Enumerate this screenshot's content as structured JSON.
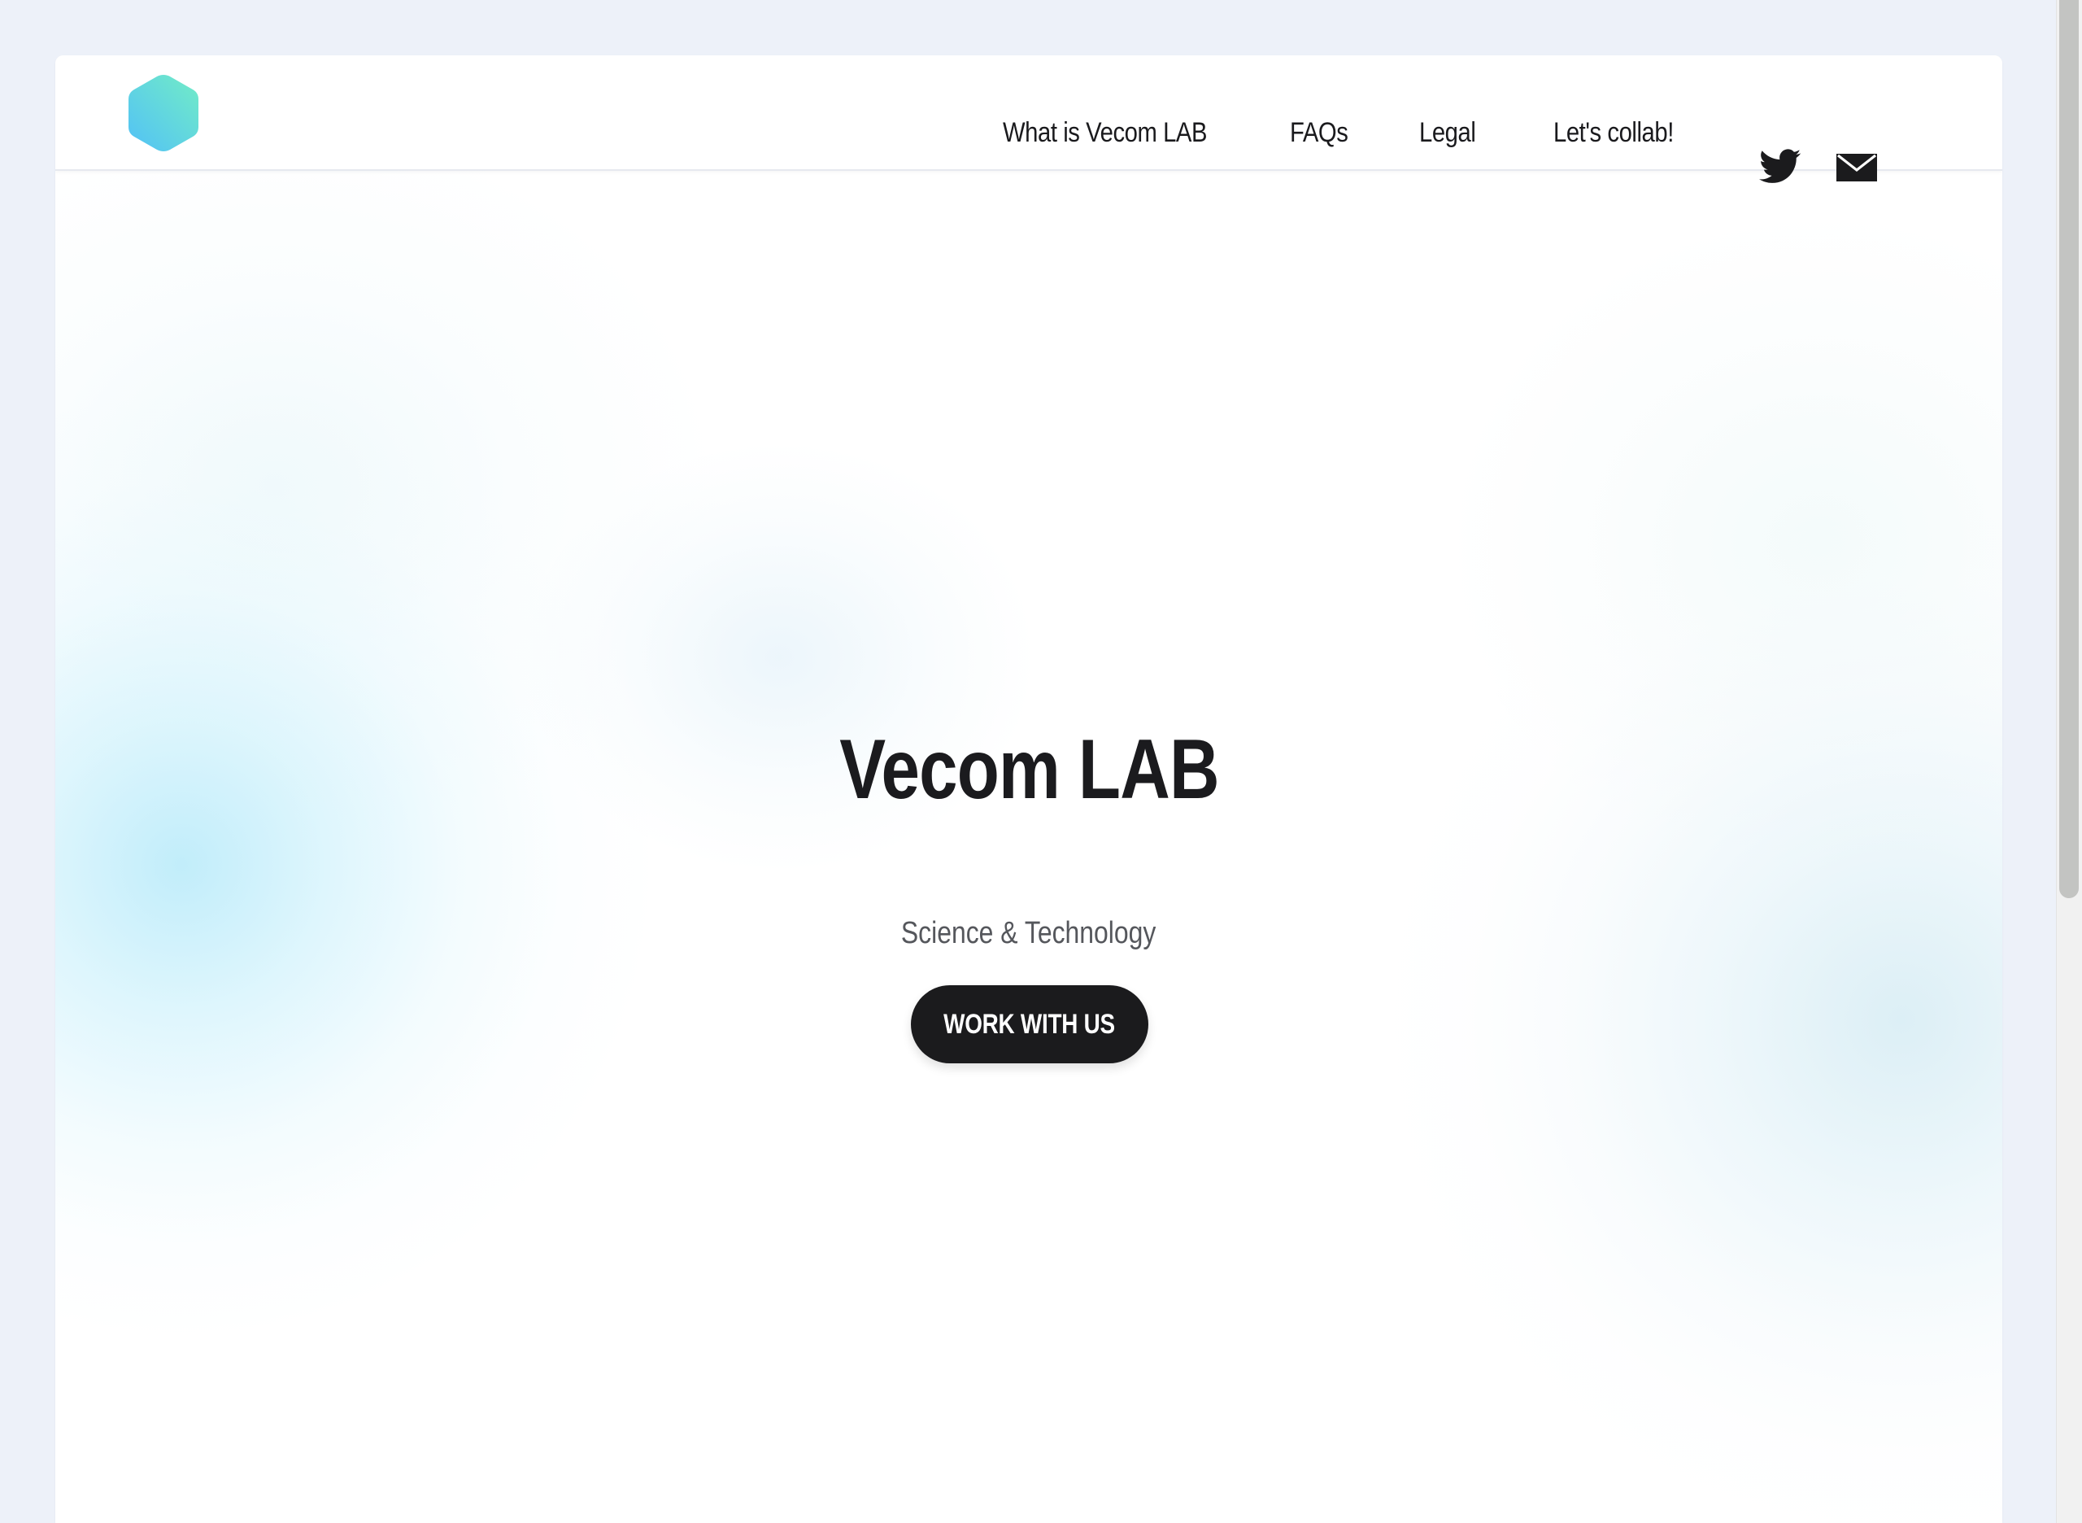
{
  "header": {
    "logo_name": "hexagon-logo",
    "nav": [
      {
        "label": "What is Vecom LAB"
      },
      {
        "label": "FAQs"
      },
      {
        "label": "Legal"
      },
      {
        "label": "Let's collab!"
      }
    ],
    "social_icons": [
      "twitter-icon",
      "mail-icon"
    ]
  },
  "hero": {
    "title": "Vecom LAB",
    "subtitle": "Science & Technology",
    "cta_label": "WORK WITH US"
  },
  "colors": {
    "page_background": "#edf1f9",
    "text_primary": "#1b1b1e",
    "text_secondary": "#55575c",
    "button_background": "#1b1b1d",
    "button_text": "#ffffff",
    "logo_gradient_start": "#5bc8f5",
    "logo_gradient_end": "#6ee7c9",
    "glow_cyan": "#c4ecf8",
    "scrollbar_thumb": "#c3c4c2"
  },
  "scrollbar": {
    "position_fraction": 0
  }
}
